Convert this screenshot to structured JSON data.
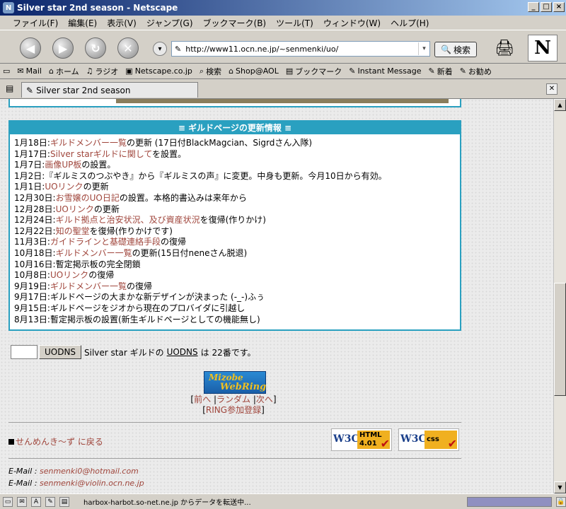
{
  "window": {
    "title": "Silver star 2nd season - Netscape"
  },
  "menu": {
    "file": "ファイル(F)",
    "edit": "編集(E)",
    "view": "表示(V)",
    "jump": "ジャンプ(G)",
    "bookmark": "ブックマーク(B)",
    "tools": "ツール(T)",
    "window": "ウィンドウ(W)",
    "help": "ヘルプ(H)"
  },
  "navbar": {
    "url": "http://www11.ocn.ne.jp/~senmenki/uo/",
    "search_label": "検索"
  },
  "bookmarks": {
    "mail": "Mail",
    "home": "ホーム",
    "radio": "ラジオ",
    "netscape": "Netscape.co.jp",
    "search": "検索",
    "shop": "Shop@AOL",
    "bookmark": "ブックマーク",
    "im": "Instant Message",
    "new": "新着",
    "recommend": "お勧め"
  },
  "tab": {
    "title": "Silver star 2nd season"
  },
  "updates": {
    "heading": "≡ ギルドページの更新情報 ≡",
    "rows": [
      {
        "date": "1月18日:",
        "link": "ギルドメンバー一覧",
        "rest": "の更新 (17日付BlackMagcian、Sigrdさん入隊)"
      },
      {
        "date": "1月17日:",
        "link": "Silver starギルドに関して",
        "rest": "を設置。"
      },
      {
        "date": "1月7日:",
        "link": "画像UP板",
        "rest": "の設置。"
      },
      {
        "date": "1月2日:",
        "link": "",
        "rest": "『ギルミスのつぶやき』から『ギルミスの声』に変更。中身も更新。今月10日から有効。"
      },
      {
        "date": "1月1日:",
        "link": "UOリンク",
        "rest": "の更新"
      },
      {
        "date": "12月30日:",
        "link": "お雪嬢のUO日記",
        "rest": "の設置。本格的書込みは来年から"
      },
      {
        "date": "12月28日:",
        "link": "UOリンク",
        "rest": "の更新"
      },
      {
        "date": "12月24日:",
        "link": "ギルド拠点と治安状況、及び資産状況",
        "rest": "を復帰(作りかけ)"
      },
      {
        "date": "12月22日:",
        "link": "知の聖堂",
        "rest": "を復帰(作りかけです)"
      },
      {
        "date": "11月3日:",
        "link": "ガイドラインと基礎連絡手段",
        "rest": "の復帰"
      },
      {
        "date": "10月18日:",
        "link": "ギルドメンバー一覧",
        "rest": "の更新(15日付neneさん脱退)"
      },
      {
        "date": "10月16日:",
        "link": "",
        "rest": "暫定掲示板の完全閉鎖"
      },
      {
        "date": "10月8日:",
        "link": "UOリンク",
        "rest": "の復帰"
      },
      {
        "date": "9月19日:",
        "link": "ギルドメンバー一覧",
        "rest": "の復帰"
      },
      {
        "date": "9月17日:",
        "link": "",
        "rest": "ギルドページの大まかな新デザインが決まった (-_-)ふぅ"
      },
      {
        "date": "9月15日:",
        "link": "",
        "rest": "ギルドページをジオから現在のプロバイダに引越し"
      },
      {
        "date": "8月13日:",
        "link": "",
        "rest": "暫定掲示板の設置(新生ギルドページとしての機能無し)"
      }
    ]
  },
  "uodns": {
    "input_value": "",
    "button": "UODNS",
    "text_before": "Silver star ギルドの",
    "link": "UODNS",
    "text_after": "は 22番です。"
  },
  "webring": {
    "logo_top": "Mizobe",
    "logo_bottom": "WebRing",
    "prev": "前へ",
    "random": "ランダム",
    "next": "次へ",
    "join": "RING参加登録"
  },
  "footer": {
    "back_link": "せんめんき～ず に戻る",
    "w3c_html": {
      "logo": "W3C",
      "label": "HTML",
      "version": "4.01"
    },
    "w3c_css": {
      "logo": "W3C",
      "label": "css"
    },
    "email_label": "E-Mail :",
    "email1": "senmenki0@hotmail.com",
    "email2": "senmenki@violin.ocn.ne.jp"
  },
  "status": {
    "text": "harbox-harbot.so-net.ne.jp からデータを転送中..."
  }
}
